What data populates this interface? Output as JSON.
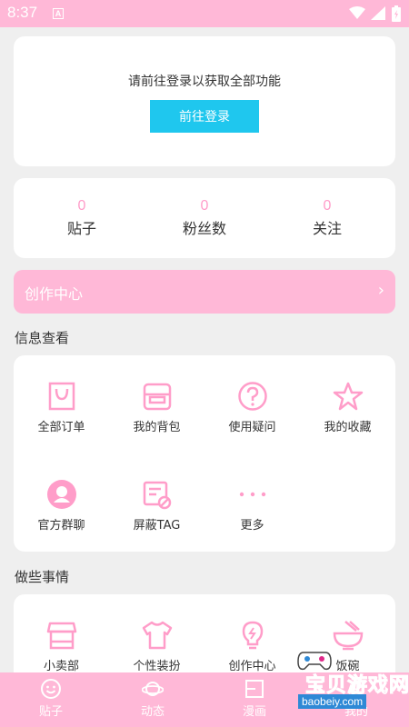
{
  "status_bar": {
    "time": "8:37",
    "notification_letter": "A"
  },
  "login": {
    "prompt": "请前往登录以获取全部功能",
    "button": "前往登录"
  },
  "stats": [
    {
      "value": "0",
      "label": "贴子"
    },
    {
      "value": "0",
      "label": "粉丝数"
    },
    {
      "value": "0",
      "label": "关注"
    }
  ],
  "creation_center": {
    "label": "创作中心",
    "chevron": "›"
  },
  "info_section": {
    "title": "信息查看",
    "items": [
      {
        "label": "全部订单",
        "icon": "shopping-bag-icon"
      },
      {
        "label": "我的背包",
        "icon": "backpack-icon"
      },
      {
        "label": "使用疑问",
        "icon": "question-icon"
      },
      {
        "label": "我的收藏",
        "icon": "star-icon"
      },
      {
        "label": "官方群聊",
        "icon": "group-chat-icon"
      },
      {
        "label": "屏蔽TAG",
        "icon": "block-tag-icon"
      },
      {
        "label": "更多",
        "icon": "more-dots-icon"
      }
    ]
  },
  "do_section": {
    "title": "做些事情",
    "items": [
      {
        "label": "小卖部",
        "icon": "shop-icon"
      },
      {
        "label": "个性装扮",
        "icon": "tshirt-icon"
      },
      {
        "label": "创作中心",
        "icon": "lightbulb-icon"
      },
      {
        "label": "饭碗",
        "icon": "bowl-icon"
      }
    ]
  },
  "bottom_nav": [
    {
      "label": "贴子",
      "icon": "smile-icon"
    },
    {
      "label": "动态",
      "icon": "planet-icon"
    },
    {
      "label": "漫画",
      "icon": "comic-icon"
    },
    {
      "label": "我的",
      "icon": "profile-icon"
    }
  ],
  "watermark": {
    "text": "宝贝游戏网",
    "url": "baobeiy.com"
  },
  "colors": {
    "pink": "#ffb8d7",
    "pink_icon": "#ff9dc9",
    "cyan": "#1fc7ee",
    "background": "#efefef"
  }
}
